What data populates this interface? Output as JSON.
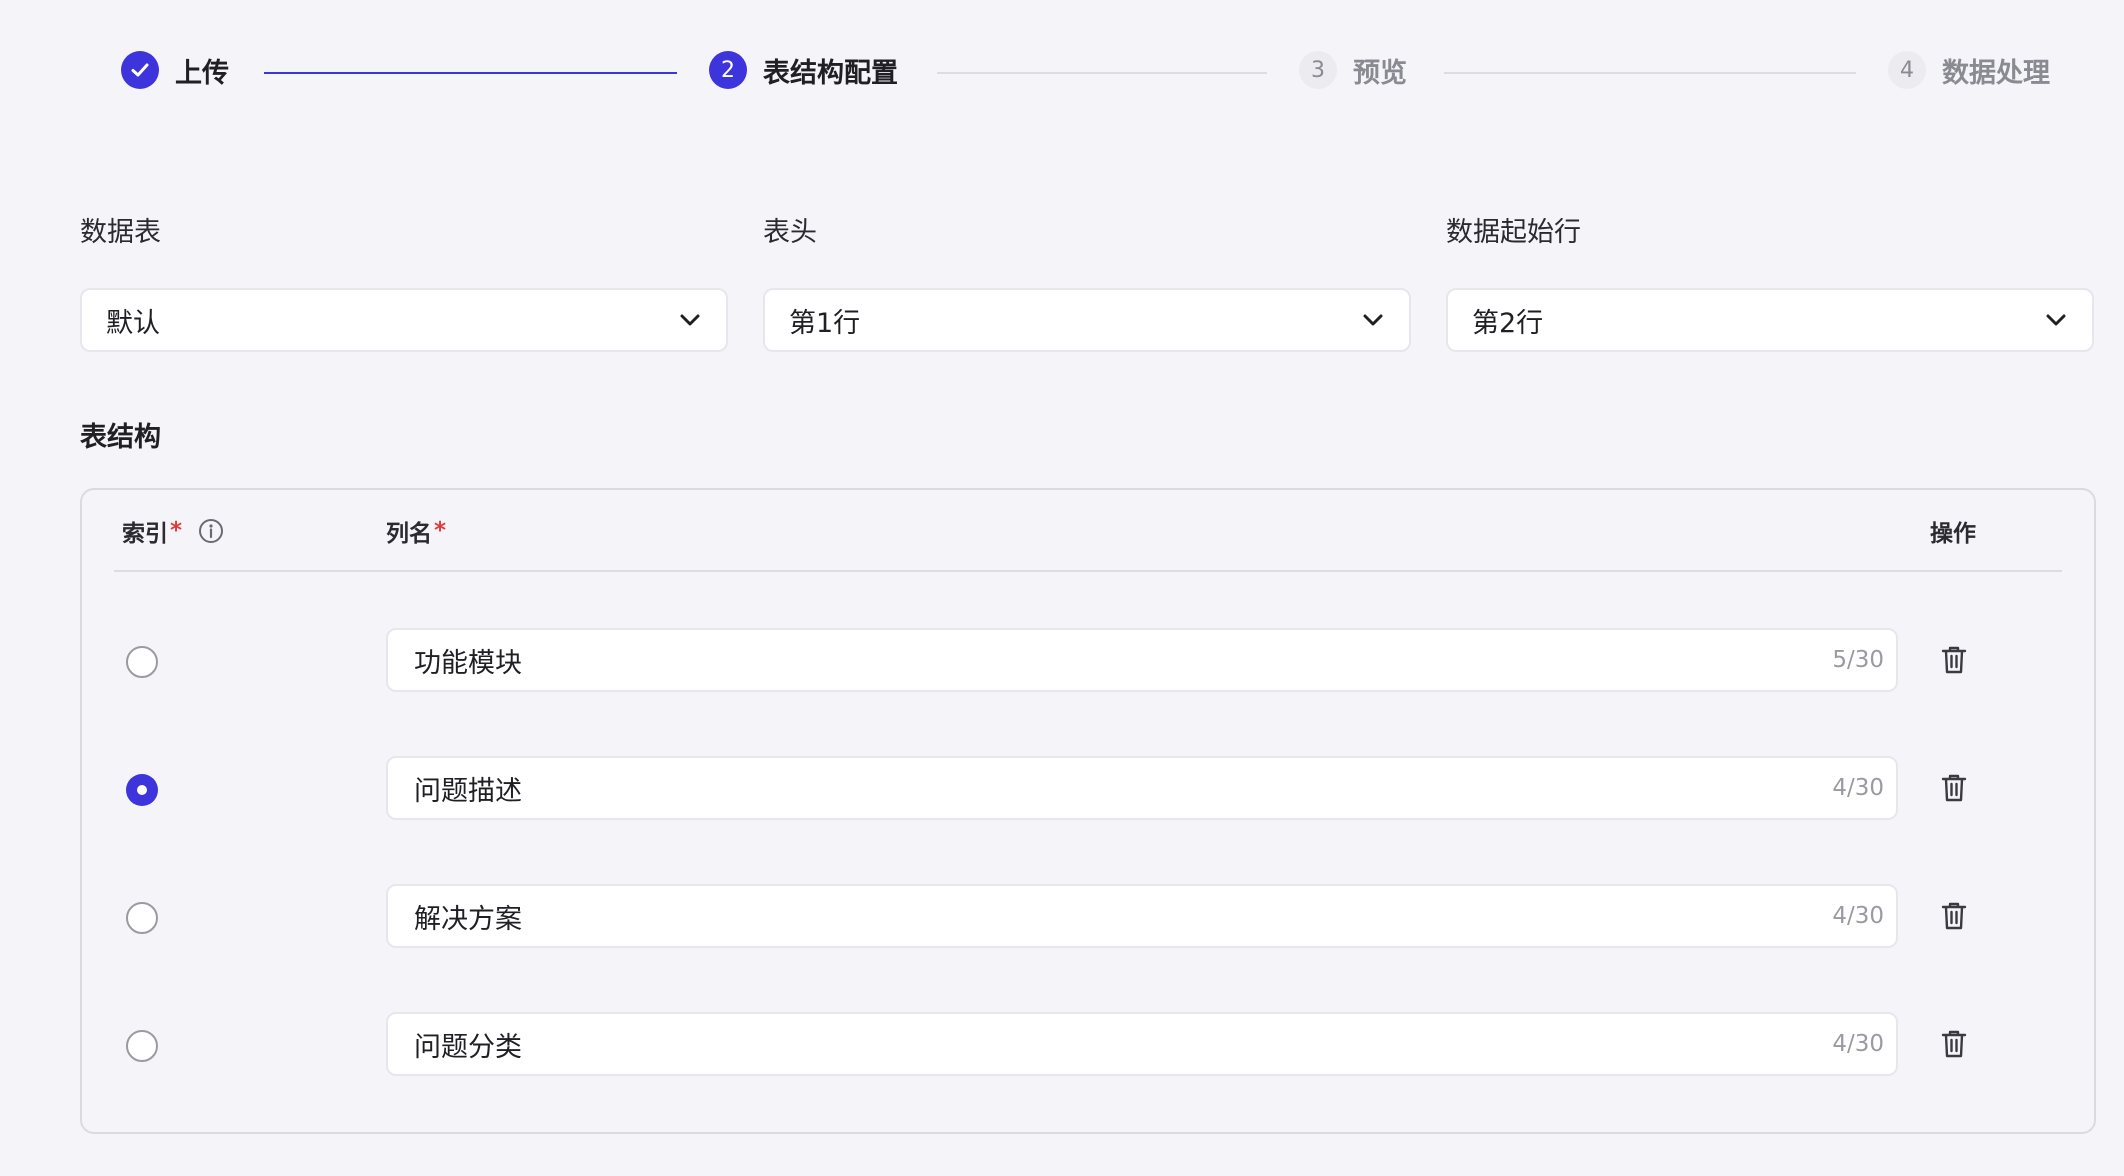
{
  "colors": {
    "accent": "#3d35db",
    "required": "#e03a3a",
    "muted": "#8a8a92",
    "background": "#f5f5f9"
  },
  "stepper": {
    "steps": [
      {
        "number": "",
        "label": "上传",
        "state": "done",
        "icon": "check-icon"
      },
      {
        "number": "2",
        "label": "表结构配置",
        "state": "active"
      },
      {
        "number": "3",
        "label": "预览",
        "state": "pending"
      },
      {
        "number": "4",
        "label": "数据处理",
        "state": "pending"
      }
    ]
  },
  "config": {
    "sheet": {
      "label": "数据表",
      "value": "默认"
    },
    "header": {
      "label": "表头",
      "value": "第1行"
    },
    "start_row": {
      "label": "数据起始行",
      "value": "第2行"
    }
  },
  "schema": {
    "title": "表结构",
    "columns": {
      "index": "索引",
      "index_required": "*",
      "name": "列名",
      "name_required": "*",
      "actions": "操作"
    },
    "rows": [
      {
        "name": "功能模块",
        "count": "5/30",
        "is_index": false
      },
      {
        "name": "问题描述",
        "count": "4/30",
        "is_index": true
      },
      {
        "name": "解决方案",
        "count": "4/30",
        "is_index": false
      },
      {
        "name": "问题分类",
        "count": "4/30",
        "is_index": false
      }
    ]
  }
}
